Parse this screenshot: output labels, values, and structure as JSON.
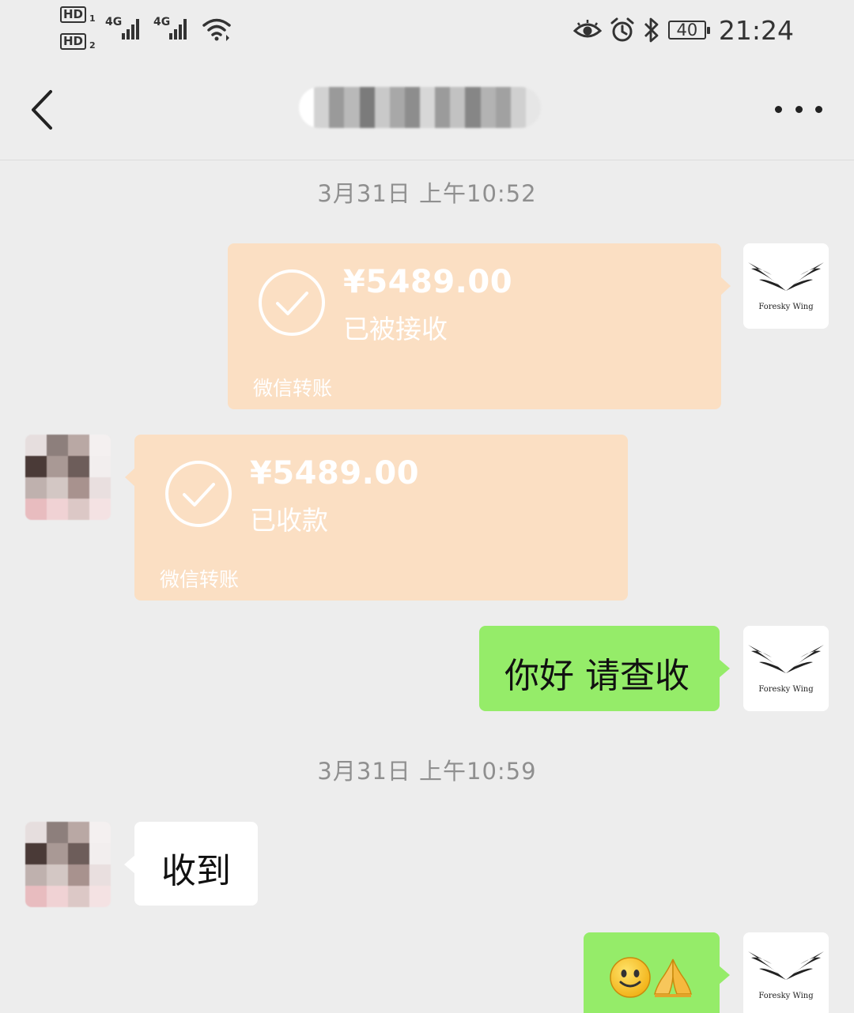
{
  "status_bar": {
    "sim1_tag": "HD",
    "sim1_index": "1",
    "sim2_tag": "HD",
    "sim2_index": "2",
    "network1": "4G",
    "network2": "4G",
    "battery_level": "40",
    "time": "21:24",
    "icons": [
      "eye-icon",
      "alarm-icon",
      "bluetooth-icon",
      "wifi-icon"
    ]
  },
  "header": {
    "back_icon": "chevron-left-icon",
    "more_icon": "more-dots-icon"
  },
  "colors": {
    "background": "#ededed",
    "sent_bubble": "#95ec69",
    "received_bubble": "#ffffff",
    "transfer_card": "#fbdfc3",
    "timestamp_text": "#8f8f8f"
  },
  "messages": {
    "timestamp_1": "3月31日 上午10:52",
    "transfer_sent": {
      "amount": "¥5489.00",
      "status": "已被接收",
      "footer": "微信转账"
    },
    "transfer_received": {
      "amount": "¥5489.00",
      "status": "已收款",
      "footer": "微信转账"
    },
    "text_sent_1": "你好 请查收",
    "timestamp_2": "3月31日 上午10:59",
    "text_received_1": "收到",
    "emoji_sent": [
      "smile-emoji",
      "pray-emoji"
    ]
  },
  "avatars": {
    "me_logo_text": "Foresky Wing"
  }
}
